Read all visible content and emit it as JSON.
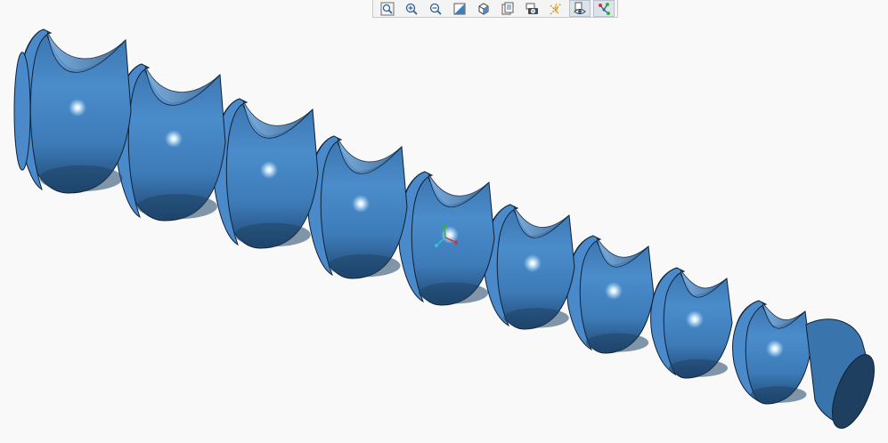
{
  "window": {
    "background": "#f9f9f9"
  },
  "model": {
    "name": "auger-screw",
    "color": "#3f7fbe",
    "shadow_color": "#1e4366",
    "edge_color": "#0f2236",
    "segments": 9
  },
  "toolbar": {
    "buttons": [
      {
        "icon": "zoom-fit-icon",
        "active": false
      },
      {
        "icon": "zoom-in-icon",
        "active": false
      },
      {
        "icon": "zoom-out-icon",
        "active": false
      },
      {
        "icon": "shading-icon",
        "active": false
      },
      {
        "icon": "view-cube-icon",
        "active": false
      },
      {
        "icon": "named-views-icon",
        "active": false
      },
      {
        "icon": "snapshot-camera-icon",
        "active": false
      },
      {
        "icon": "datum-display-icon",
        "active": false
      },
      {
        "icon": "visibility-icon",
        "active": true
      },
      {
        "icon": "spin-center-icon",
        "active": true
      }
    ]
  },
  "triad": {
    "x_color": "#d93030",
    "y_color": "#2fb82f",
    "z_color": "#2fc4d4"
  }
}
